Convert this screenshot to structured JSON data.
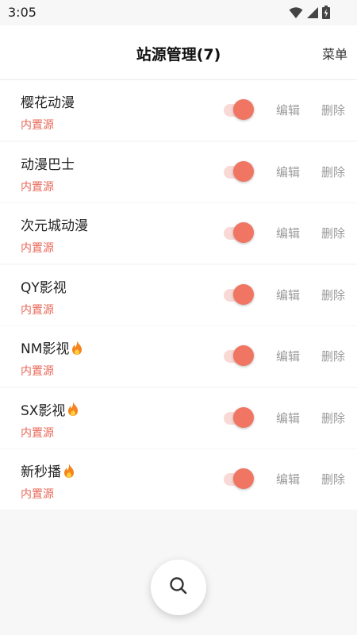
{
  "status_bar": {
    "time": "3:05"
  },
  "app_bar": {
    "title": "站源管理(7)",
    "menu_label": "菜单"
  },
  "sources": [
    {
      "name": "樱花动漫",
      "type": "内置源",
      "enabled": true,
      "hot": false
    },
    {
      "name": "动漫巴士",
      "type": "内置源",
      "enabled": true,
      "hot": false
    },
    {
      "name": "次元城动漫",
      "type": "内置源",
      "enabled": true,
      "hot": false
    },
    {
      "name": "QY影视",
      "type": "内置源",
      "enabled": true,
      "hot": false
    },
    {
      "name": "NM影视",
      "type": "内置源",
      "enabled": true,
      "hot": true
    },
    {
      "name": "SX影视",
      "type": "内置源",
      "enabled": true,
      "hot": true
    },
    {
      "name": "新秒播",
      "type": "内置源",
      "enabled": true,
      "hot": true
    }
  ],
  "actions": {
    "edit_label": "编辑",
    "delete_label": "删除"
  },
  "fab": {
    "icon": "search-icon"
  },
  "colors": {
    "accent": "#f07563",
    "accent_track": "#f9d9d5",
    "subtitle": "#e8685a",
    "action_text": "#9a9a9a"
  }
}
